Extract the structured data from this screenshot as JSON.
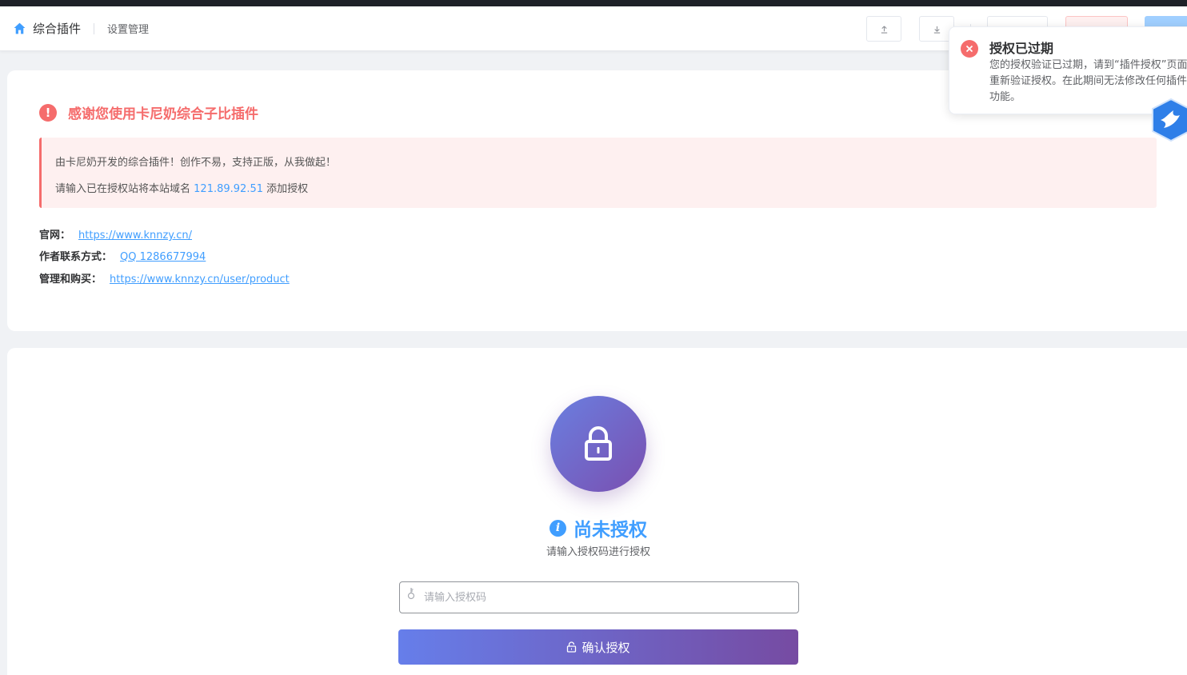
{
  "header": {
    "brand_title": "综合插件",
    "breadcrumb": "设置管理",
    "buttons": {
      "import_label": "",
      "export_label": "",
      "reset_label": "",
      "delete_label": "",
      "save_label": ""
    }
  },
  "notice": {
    "title": "感谢您使用卡尼奶综合子比插件",
    "alert_line1": "由卡尼奶开发的综合插件！创作不易，支持正版，从我做起！",
    "alert_line2_prefix": "请输入已在授权站将本站域名",
    "alert_domain": "121.89.92.51",
    "alert_line2_suffix": "添加授权"
  },
  "links": [
    {
      "label": "官网：",
      "text": "https://www.knnzy.cn/"
    },
    {
      "label": "作者联系方式：",
      "text": "QQ 1286677994"
    },
    {
      "label": "管理和购买：",
      "text": "https://www.knnzy.cn/user/product"
    }
  ],
  "auth": {
    "status_title": "尚未授权",
    "subtitle": "请输入授权码进行授权",
    "input_placeholder": "请输入授权码",
    "input_value": "",
    "confirm_label": "确认授权"
  },
  "toast": {
    "title": "授权已过期",
    "message": "您的授权验证已过期，请到“插件授权”页面重新验证授权。在此期间无法修改任何插件功能。"
  },
  "colors": {
    "primary": "#409eff",
    "danger": "#f56c6c",
    "gradient_start": "#667eea",
    "gradient_end": "#764ba2"
  }
}
